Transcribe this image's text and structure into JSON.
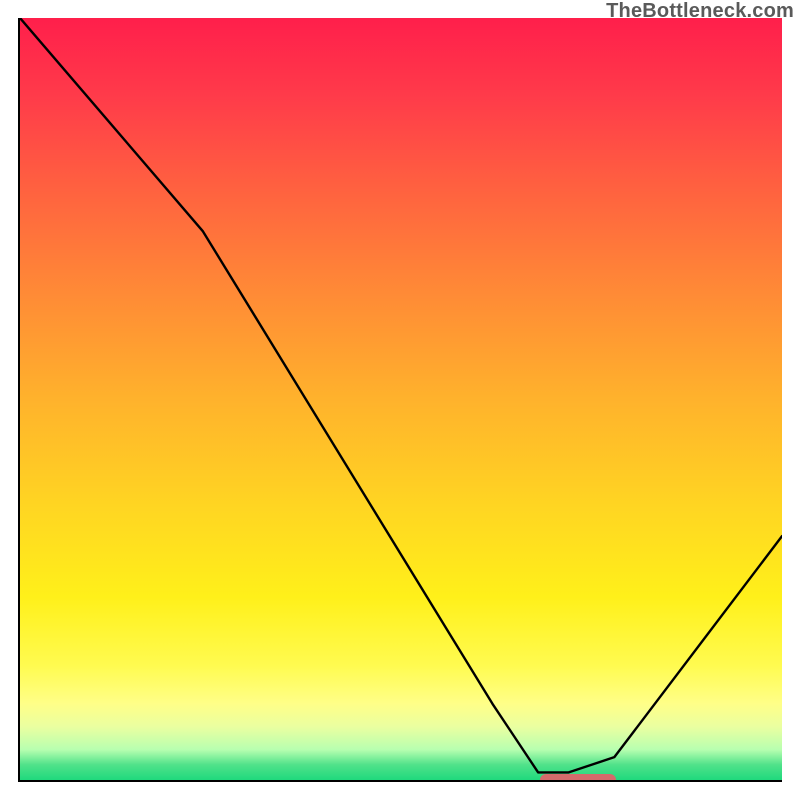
{
  "watermark": "TheBottleneck.com",
  "chart_data": {
    "type": "line",
    "title": "",
    "xlabel": "",
    "ylabel": "",
    "xlim": [
      0,
      100
    ],
    "ylim": [
      0,
      100
    ],
    "grid": false,
    "legend": false,
    "series": [
      {
        "name": "bottleneck-curve",
        "x": [
          0,
          24,
          62,
          68,
          72,
          78,
          100
        ],
        "y": [
          100,
          72,
          10,
          1,
          1,
          3,
          32
        ]
      }
    ],
    "marker": {
      "name": "optimal-range",
      "x_start": 68,
      "x_end": 78,
      "y": 0,
      "color": "#d46b6b"
    },
    "background": {
      "type": "vertical-gradient",
      "stops": [
        {
          "pos": 0.0,
          "color": "#ff1f4b"
        },
        {
          "pos": 0.5,
          "color": "#ffb22c"
        },
        {
          "pos": 0.85,
          "color": "#fffb50"
        },
        {
          "pos": 1.0,
          "color": "#1fd97d"
        }
      ]
    }
  }
}
